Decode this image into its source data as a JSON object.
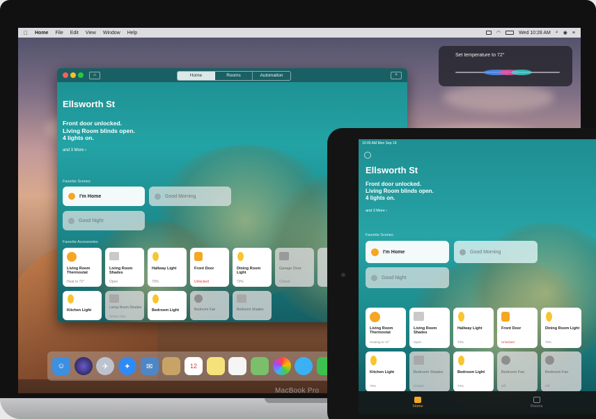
{
  "mac": {
    "menubar": {
      "items": [
        "Home",
        "File",
        "Edit",
        "View",
        "Window",
        "Help"
      ],
      "clock": "Wed 10:28 AM"
    },
    "siri": {
      "prompt": "Set temperature to 72°"
    },
    "window": {
      "tabs": [
        "Home",
        "Rooms",
        "Automation"
      ],
      "title": "Ellsworth St",
      "status": [
        "Front door unlocked.",
        "Living Room blinds open.",
        "4 lights on."
      ],
      "more": "and 3 More ›",
      "scenes_label": "Favorite Scenes",
      "scenes": [
        {
          "label": "I'm Home",
          "active": true
        },
        {
          "label": "Good Morning",
          "active": false
        },
        {
          "label": "Good Night",
          "active": false
        }
      ],
      "accessories_label": "Favorite Accessories",
      "tiles_row1": [
        {
          "name": "Living Room Thermostat",
          "state": "Heat to 72°"
        },
        {
          "name": "Living Room Shades",
          "state": "Open"
        },
        {
          "name": "Hallway Light",
          "state": "70%"
        },
        {
          "name": "Front Door",
          "state": "Unlocked"
        },
        {
          "name": "Dining Room Light",
          "state": "70%"
        },
        {
          "name": "Garage Door",
          "state": "Closed"
        }
      ],
      "tiles_row2": [
        {
          "name": "Kitchen Light",
          "state": ""
        },
        {
          "name": "Living Room Shades",
          "state": "Sensor Sun"
        },
        {
          "name": "Bedroom Light",
          "state": ""
        },
        {
          "name": "Bedroom Fan",
          "state": ""
        },
        {
          "name": "Bedroom Shades",
          "state": ""
        }
      ]
    },
    "model": "MacBook Pro"
  },
  "ipad": {
    "status": "10:05 AM  Mon Sep 19",
    "title": "Ellsworth St",
    "status_lines": [
      "Front door unlocked.",
      "Living Room blinds open.",
      "4 lights on."
    ],
    "more": "and 3 More ›",
    "scenes_label": "Favorite Scenes",
    "scenes": [
      {
        "label": "I'm Home",
        "active": true
      },
      {
        "label": "Good Morning",
        "active": false
      },
      {
        "label": "Good Night",
        "active": false
      }
    ],
    "tiles_row1": [
      {
        "name": "Living Room Thermostat",
        "state": "Heating to 72°"
      },
      {
        "name": "Living Room Shades",
        "state": "Open"
      },
      {
        "name": "Hallway Light",
        "state": "70%"
      },
      {
        "name": "Front Door",
        "state": "Unlocked"
      },
      {
        "name": "Dining Room Light",
        "state": "70%"
      }
    ],
    "tiles_row2": [
      {
        "name": "Kitchen Light",
        "state": "70%"
      },
      {
        "name": "Bedroom Shades",
        "state": "Closed"
      },
      {
        "name": "Bedroom Light",
        "state": "70%"
      },
      {
        "name": "Bedroom Fan",
        "state": "Off"
      },
      {
        "name": "Bedroom Fan",
        "state": "Off"
      }
    ],
    "tabbar": [
      "Home",
      "Rooms"
    ]
  },
  "colors": {
    "accent": "#f5a623",
    "teal": "#23a3a5",
    "alert": "#e0392f"
  }
}
